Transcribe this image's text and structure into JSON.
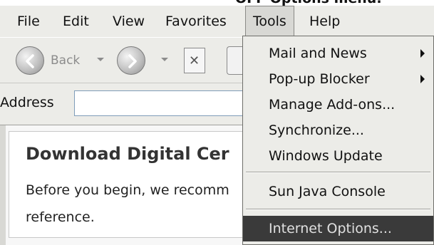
{
  "top_clip_text": "OFF Options menu.",
  "menubar": {
    "items": [
      {
        "label": "File"
      },
      {
        "label": "Edit"
      },
      {
        "label": "View"
      },
      {
        "label": "Favorites"
      },
      {
        "label": "Tools"
      },
      {
        "label": "Help"
      }
    ],
    "active": "Tools"
  },
  "toolbar": {
    "back_label": "Back",
    "back_icon": "back-arrow-icon",
    "forward_icon": "forward-arrow-icon",
    "stop_icon": "stop-icon",
    "refresh_icon": "refresh-icon"
  },
  "address": {
    "label": "Address",
    "value": ""
  },
  "content": {
    "heading": "Download Digital Cer",
    "line1": "Before you begin, we recomm",
    "line2": "reference."
  },
  "tools_menu": {
    "items": [
      {
        "label": "Mail and News",
        "submenu": true
      },
      {
        "label": "Pop-up Blocker",
        "submenu": true
      },
      {
        "label": "Manage Add-ons...",
        "submenu": false
      },
      {
        "label": "Synchronize...",
        "submenu": false
      },
      {
        "label": "Windows Update",
        "submenu": false
      },
      {
        "label": "Sun Java Console",
        "submenu": false
      },
      {
        "label": "Internet Options...",
        "submenu": false,
        "highlighted": true
      }
    ]
  },
  "colors": {
    "chrome": "#ecece8",
    "highlight": "#3a3a3a"
  }
}
